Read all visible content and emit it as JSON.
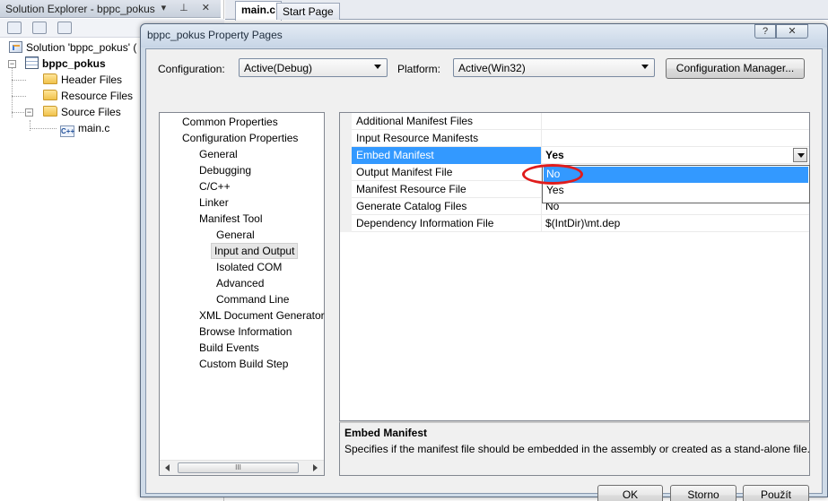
{
  "solution_explorer": {
    "title": "Solution Explorer - bppc_pokus",
    "title_icons": "▾ ⊥ ✕",
    "tree": [
      {
        "label": "Solution 'bppc_pokus' (",
        "icon": "solution-icon"
      },
      {
        "label": "bppc_pokus",
        "icon": "project-icon",
        "bold": true
      },
      {
        "label": "Header Files",
        "icon": "folder-icon"
      },
      {
        "label": "Resource Files",
        "icon": "folder-icon"
      },
      {
        "label": "Source Files",
        "icon": "folder-open-icon"
      },
      {
        "label": "main.c",
        "icon": "c-file-icon"
      }
    ]
  },
  "editor_tabs": [
    {
      "label": "main.c",
      "active": true
    },
    {
      "label": "Start Page",
      "active": false
    }
  ],
  "dialog": {
    "title": "bppc_pokus Property Pages",
    "help_label": "?",
    "close_label": "✕",
    "configuration_label": "Configuration:",
    "configuration_value": "Active(Debug)",
    "platform_label": "Platform:",
    "platform_value": "Active(Win32)",
    "config_manager_label": "Configuration Manager...",
    "tree": [
      {
        "label": "Common Properties",
        "level": 0
      },
      {
        "label": "Configuration Properties",
        "level": 0
      },
      {
        "label": "General",
        "level": 1
      },
      {
        "label": "Debugging",
        "level": 1
      },
      {
        "label": "C/C++",
        "level": 1
      },
      {
        "label": "Linker",
        "level": 1
      },
      {
        "label": "Manifest Tool",
        "level": 1
      },
      {
        "label": "General",
        "level": 2
      },
      {
        "label": "Input and Output",
        "level": 2,
        "selected": true
      },
      {
        "label": "Isolated COM",
        "level": 2
      },
      {
        "label": "Advanced",
        "level": 2
      },
      {
        "label": "Command Line",
        "level": 2
      },
      {
        "label": "XML Document Generator",
        "level": 1
      },
      {
        "label": "Browse Information",
        "level": 1
      },
      {
        "label": "Build Events",
        "level": 1
      },
      {
        "label": "Custom Build Step",
        "level": 1
      }
    ],
    "scroll_thumb_grip": "III",
    "properties": [
      {
        "name": "Additional Manifest Files",
        "value": ""
      },
      {
        "name": "Input Resource Manifests",
        "value": ""
      },
      {
        "name": "Embed Manifest",
        "value": "Yes",
        "selected": true
      },
      {
        "name": "Output Manifest File",
        "value": ""
      },
      {
        "name": "Manifest Resource File",
        "value": ""
      },
      {
        "name": "Generate Catalog Files",
        "value": "No"
      },
      {
        "name": "Dependency Information File",
        "value": "$(IntDir)\\mt.dep"
      }
    ],
    "dropdown_options": [
      {
        "label": "No",
        "highlighted": true
      },
      {
        "label": "Yes",
        "highlighted": false
      }
    ],
    "description": {
      "title": "Embed Manifest",
      "text": "Specifies if the manifest file should be embedded in the assembly or created as a stand-alone file."
    },
    "buttons": {
      "ok": "OK",
      "cancel": "Storno",
      "apply": "Použít"
    },
    "colors": {
      "selection": "#3399ff",
      "annotation_circle": "#e01c1c",
      "dialog_frame": "#cfdbe8"
    }
  }
}
